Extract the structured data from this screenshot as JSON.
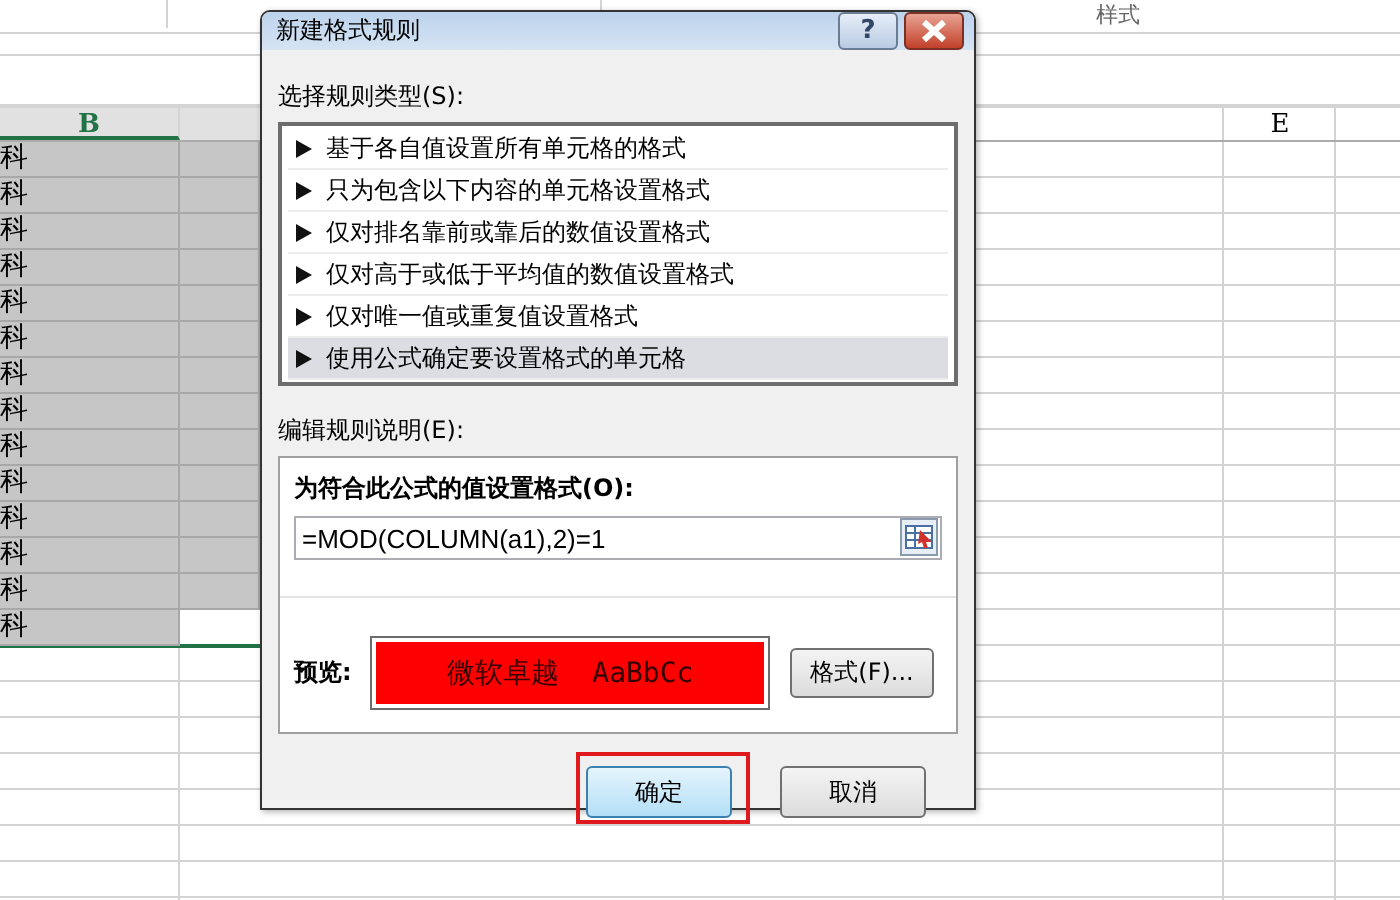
{
  "ribbon": {
    "group_label": "样式"
  },
  "sheet": {
    "columns": [
      {
        "label": "B"
      },
      {
        "label": "E"
      }
    ],
    "rows": [
      {
        "cell_b": "科",
        "b_selected": true,
        "c_selected": true
      },
      {
        "cell_b": "科",
        "b_selected": true,
        "c_selected": true
      },
      {
        "cell_b": "科",
        "b_selected": true,
        "c_selected": true
      },
      {
        "cell_b": "科",
        "b_selected": true,
        "c_selected": true
      },
      {
        "cell_b": "科",
        "b_selected": true,
        "c_selected": true
      },
      {
        "cell_b": "科",
        "b_selected": true,
        "c_selected": true
      },
      {
        "cell_b": "科",
        "b_selected": true,
        "c_selected": true
      },
      {
        "cell_b": "科",
        "b_selected": true,
        "c_selected": true
      },
      {
        "cell_b": "科",
        "b_selected": true,
        "c_selected": true
      },
      {
        "cell_b": "科",
        "b_selected": true,
        "c_selected": true
      },
      {
        "cell_b": "科",
        "b_selected": true,
        "c_selected": true
      },
      {
        "cell_b": "科",
        "b_selected": true,
        "c_selected": true
      },
      {
        "cell_b": "科",
        "b_selected": true,
        "c_selected": true
      },
      {
        "cell_b": "科",
        "b_selected": true,
        "c_selected": false
      }
    ]
  },
  "dialog": {
    "title": "新建格式规则",
    "help_button": "?",
    "rule_type_label": "选择规则类型(S):",
    "rule_types": [
      {
        "label": "基于各自值设置所有单元格的格式",
        "selected": false
      },
      {
        "label": "只为包含以下内容的单元格设置格式",
        "selected": false
      },
      {
        "label": "仅对排名靠前或靠后的数值设置格式",
        "selected": false
      },
      {
        "label": "仅对高于或低于平均值的数值设置格式",
        "selected": false
      },
      {
        "label": "仅对唯一值或重复值设置格式",
        "selected": false
      },
      {
        "label": "使用公式确定要设置格式的单元格",
        "selected": true
      }
    ],
    "description_label": "编辑规则说明(E):",
    "formula_label": "为符合此公式的值设置格式(O):",
    "formula": "=MOD(COLUMN(a1),2)=1",
    "preview_label": "预览:",
    "preview_text": "微软卓越  AaBbCc",
    "format_button": "格式(F)...",
    "buttons": [
      {
        "label": "确定",
        "highlighted": true
      },
      {
        "label": "取消",
        "highlighted": false
      }
    ]
  }
}
